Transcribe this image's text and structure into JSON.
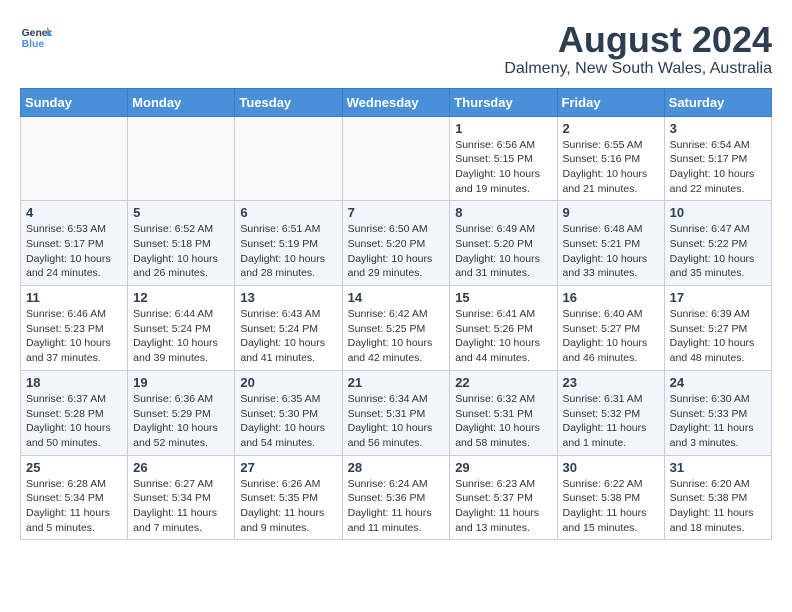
{
  "header": {
    "logo_line1": "General",
    "logo_line2": "Blue",
    "month_year": "August 2024",
    "location": "Dalmeny, New South Wales, Australia"
  },
  "weekdays": [
    "Sunday",
    "Monday",
    "Tuesday",
    "Wednesday",
    "Thursday",
    "Friday",
    "Saturday"
  ],
  "weeks": [
    [
      {
        "day": "",
        "info": ""
      },
      {
        "day": "",
        "info": ""
      },
      {
        "day": "",
        "info": ""
      },
      {
        "day": "",
        "info": ""
      },
      {
        "day": "1",
        "info": "Sunrise: 6:56 AM\nSunset: 5:15 PM\nDaylight: 10 hours\nand 19 minutes."
      },
      {
        "day": "2",
        "info": "Sunrise: 6:55 AM\nSunset: 5:16 PM\nDaylight: 10 hours\nand 21 minutes."
      },
      {
        "day": "3",
        "info": "Sunrise: 6:54 AM\nSunset: 5:17 PM\nDaylight: 10 hours\nand 22 minutes."
      }
    ],
    [
      {
        "day": "4",
        "info": "Sunrise: 6:53 AM\nSunset: 5:17 PM\nDaylight: 10 hours\nand 24 minutes."
      },
      {
        "day": "5",
        "info": "Sunrise: 6:52 AM\nSunset: 5:18 PM\nDaylight: 10 hours\nand 26 minutes."
      },
      {
        "day": "6",
        "info": "Sunrise: 6:51 AM\nSunset: 5:19 PM\nDaylight: 10 hours\nand 28 minutes."
      },
      {
        "day": "7",
        "info": "Sunrise: 6:50 AM\nSunset: 5:20 PM\nDaylight: 10 hours\nand 29 minutes."
      },
      {
        "day": "8",
        "info": "Sunrise: 6:49 AM\nSunset: 5:20 PM\nDaylight: 10 hours\nand 31 minutes."
      },
      {
        "day": "9",
        "info": "Sunrise: 6:48 AM\nSunset: 5:21 PM\nDaylight: 10 hours\nand 33 minutes."
      },
      {
        "day": "10",
        "info": "Sunrise: 6:47 AM\nSunset: 5:22 PM\nDaylight: 10 hours\nand 35 minutes."
      }
    ],
    [
      {
        "day": "11",
        "info": "Sunrise: 6:46 AM\nSunset: 5:23 PM\nDaylight: 10 hours\nand 37 minutes."
      },
      {
        "day": "12",
        "info": "Sunrise: 6:44 AM\nSunset: 5:24 PM\nDaylight: 10 hours\nand 39 minutes."
      },
      {
        "day": "13",
        "info": "Sunrise: 6:43 AM\nSunset: 5:24 PM\nDaylight: 10 hours\nand 41 minutes."
      },
      {
        "day": "14",
        "info": "Sunrise: 6:42 AM\nSunset: 5:25 PM\nDaylight: 10 hours\nand 42 minutes."
      },
      {
        "day": "15",
        "info": "Sunrise: 6:41 AM\nSunset: 5:26 PM\nDaylight: 10 hours\nand 44 minutes."
      },
      {
        "day": "16",
        "info": "Sunrise: 6:40 AM\nSunset: 5:27 PM\nDaylight: 10 hours\nand 46 minutes."
      },
      {
        "day": "17",
        "info": "Sunrise: 6:39 AM\nSunset: 5:27 PM\nDaylight: 10 hours\nand 48 minutes."
      }
    ],
    [
      {
        "day": "18",
        "info": "Sunrise: 6:37 AM\nSunset: 5:28 PM\nDaylight: 10 hours\nand 50 minutes."
      },
      {
        "day": "19",
        "info": "Sunrise: 6:36 AM\nSunset: 5:29 PM\nDaylight: 10 hours\nand 52 minutes."
      },
      {
        "day": "20",
        "info": "Sunrise: 6:35 AM\nSunset: 5:30 PM\nDaylight: 10 hours\nand 54 minutes."
      },
      {
        "day": "21",
        "info": "Sunrise: 6:34 AM\nSunset: 5:31 PM\nDaylight: 10 hours\nand 56 minutes."
      },
      {
        "day": "22",
        "info": "Sunrise: 6:32 AM\nSunset: 5:31 PM\nDaylight: 10 hours\nand 58 minutes."
      },
      {
        "day": "23",
        "info": "Sunrise: 6:31 AM\nSunset: 5:32 PM\nDaylight: 11 hours\nand 1 minute."
      },
      {
        "day": "24",
        "info": "Sunrise: 6:30 AM\nSunset: 5:33 PM\nDaylight: 11 hours\nand 3 minutes."
      }
    ],
    [
      {
        "day": "25",
        "info": "Sunrise: 6:28 AM\nSunset: 5:34 PM\nDaylight: 11 hours\nand 5 minutes."
      },
      {
        "day": "26",
        "info": "Sunrise: 6:27 AM\nSunset: 5:34 PM\nDaylight: 11 hours\nand 7 minutes."
      },
      {
        "day": "27",
        "info": "Sunrise: 6:26 AM\nSunset: 5:35 PM\nDaylight: 11 hours\nand 9 minutes."
      },
      {
        "day": "28",
        "info": "Sunrise: 6:24 AM\nSunset: 5:36 PM\nDaylight: 11 hours\nand 11 minutes."
      },
      {
        "day": "29",
        "info": "Sunrise: 6:23 AM\nSunset: 5:37 PM\nDaylight: 11 hours\nand 13 minutes."
      },
      {
        "day": "30",
        "info": "Sunrise: 6:22 AM\nSunset: 5:38 PM\nDaylight: 11 hours\nand 15 minutes."
      },
      {
        "day": "31",
        "info": "Sunrise: 6:20 AM\nSunset: 5:38 PM\nDaylight: 11 hours\nand 18 minutes."
      }
    ]
  ]
}
